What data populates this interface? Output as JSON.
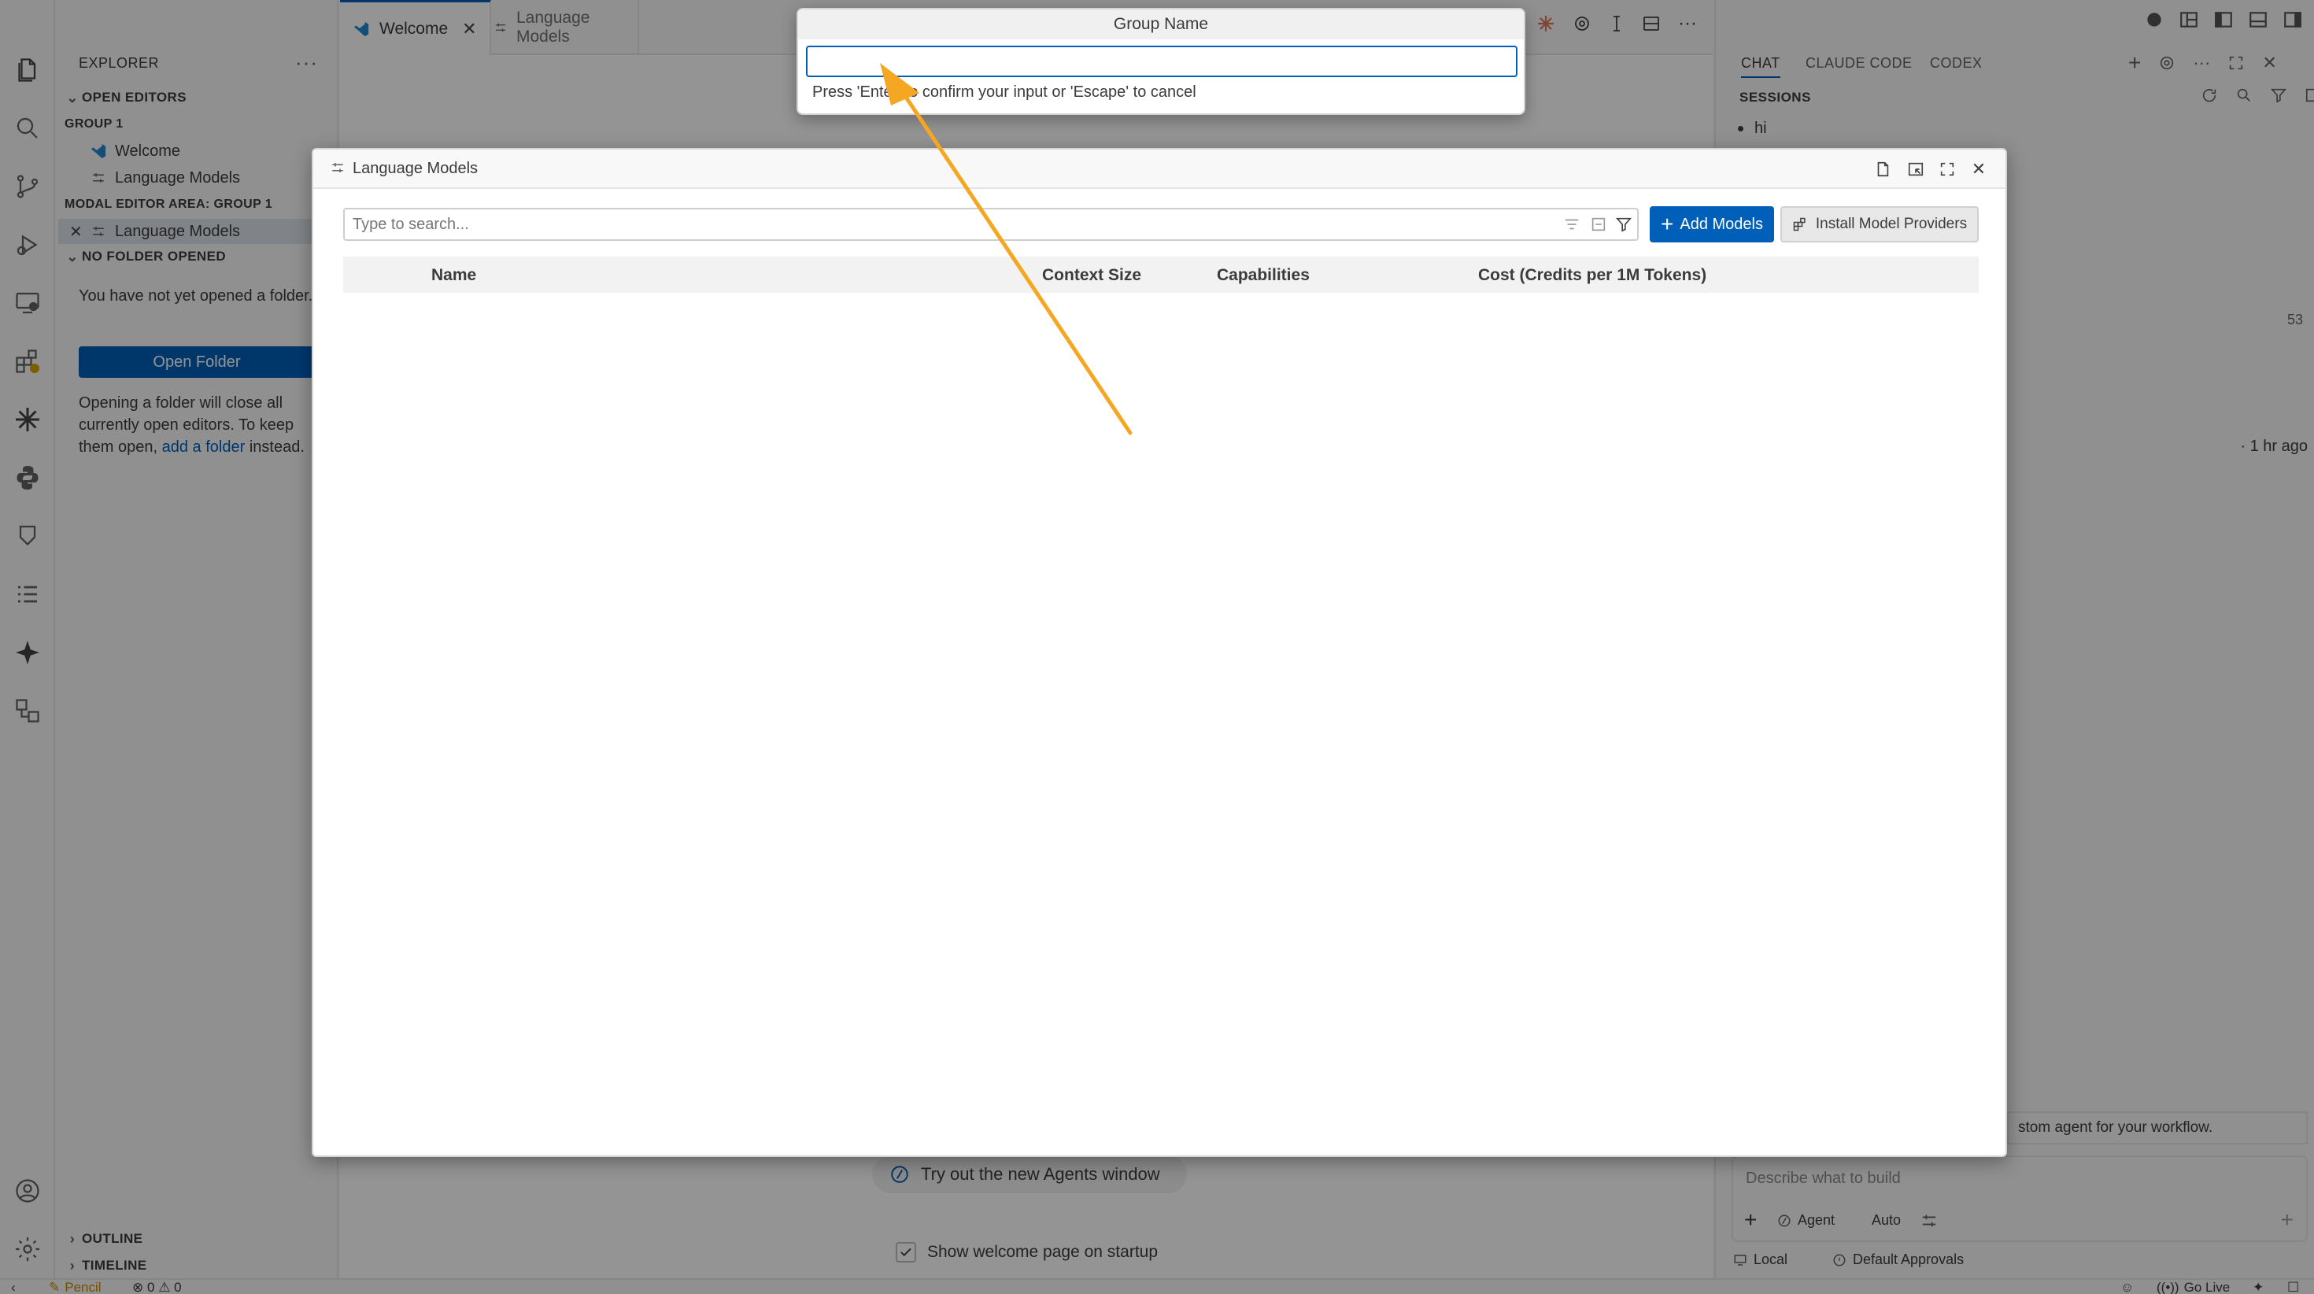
{
  "explorer": {
    "title": "EXPLORER",
    "open_editors": "OPEN EDITORS",
    "group1": "GROUP 1",
    "group1_items": [
      "Welcome",
      "Language Models"
    ],
    "modal_area": "MODAL EDITOR AREA: GROUP 1",
    "modal_area_item": "Language Models",
    "no_folder": "NO FOLDER OPENED",
    "no_folder_text": "You have not yet opened a folder.",
    "open_folder_button": "Open Folder",
    "info_before": "Opening a folder will close all currently open editors. To keep them open, ",
    "info_link": "add a folder",
    "info_after": " instead.",
    "outline": "OUTLINE",
    "timeline": "TIMELINE"
  },
  "editor": {
    "tabs": [
      "Welcome",
      "Language Models"
    ],
    "try_agents": "Try out the new Agents window",
    "show_welcome": "Show welcome page on startup"
  },
  "quick_input": {
    "title": "Group Name",
    "value": "",
    "message": "Press 'Enter' to confirm your input or 'Escape' to cancel"
  },
  "modal": {
    "title": "Language Models",
    "search_placeholder": "Type to search...",
    "add_models": "Add Models",
    "install_providers": "Install Model Providers",
    "columns": [
      "Name",
      "Context Size",
      "Capabilities",
      "Cost (Credits per 1M Tokens)"
    ],
    "rows": []
  },
  "chat": {
    "tabs": [
      "CHAT",
      "CLAUDE CODE",
      "CODEX"
    ],
    "sessions_title": "SESSIONS",
    "session_item": "hi",
    "count": "53",
    "time_ago": "· 1 hr ago",
    "hint": "stom agent for your workflow.",
    "input_placeholder": "Describe what to build",
    "agent_label": "Agent",
    "auto_label": "Auto",
    "local_label": "Local",
    "approvals_label": "Default Approvals"
  },
  "status": {
    "pencil": "Pencil",
    "errors": "0",
    "warnings": "0",
    "go_live": "Go Live"
  },
  "colors": {
    "accent": "#005fb8",
    "arrow": "#f5a623",
    "overlay": "rgba(0,0,0,0.42)"
  }
}
